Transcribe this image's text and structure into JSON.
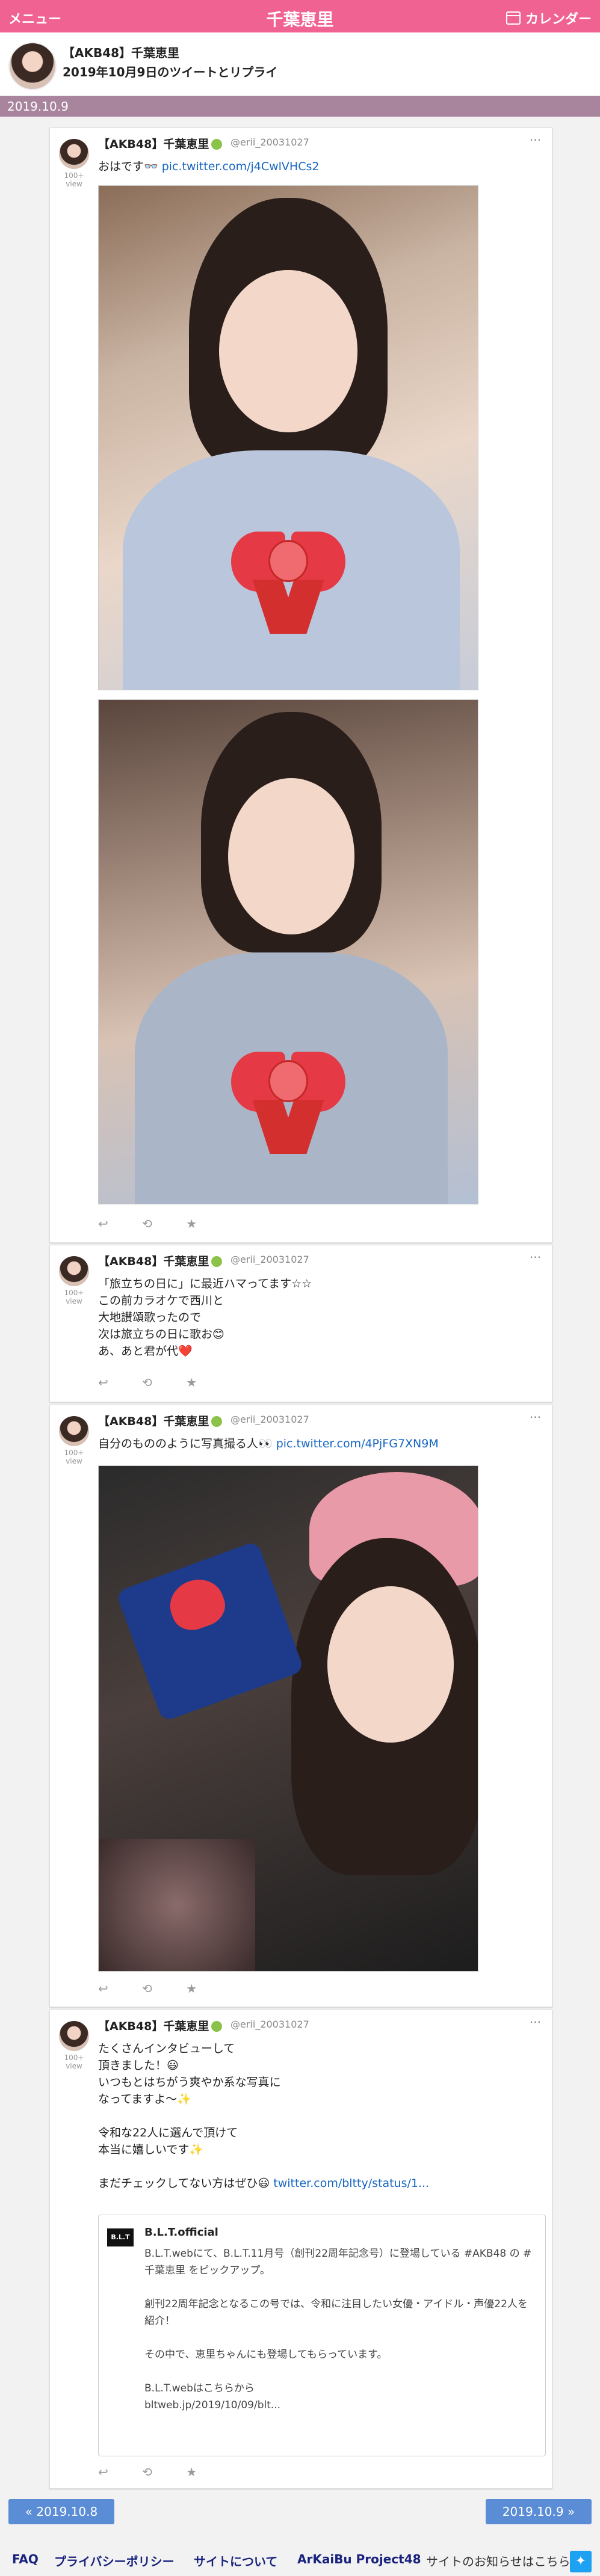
{
  "topbar": {
    "menu": "メニュー",
    "title": "千葉恵里",
    "calendar": "カレンダー"
  },
  "header": {
    "name": "【AKB48】千葉恵里",
    "subtitle": "2019年10月9日のツイートとリプライ"
  },
  "date_label": "2019.10.9",
  "tweets": [
    {
      "user": "【AKB48】千葉恵里",
      "handle": "@erii_20031027",
      "views": "100+\nview",
      "text": "おはです👓 ",
      "link": "pic.twitter.com/j4CwlVHCs2"
    },
    {
      "user": "【AKB48】千葉恵里",
      "handle": "@erii_20031027",
      "views": "100+\nview",
      "text": "「旅立ちの日に」に最近ハマってます☆☆\nこの前カラオケで西川と\n大地讃頌歌ったので\n次は旅立ちの日に歌お😊\nあ、あと君が代❤️"
    },
    {
      "user": "【AKB48】千葉恵里",
      "handle": "@erii_20031027",
      "views": "100+\nview",
      "text": "自分のもののように写真撮る人👀 ",
      "link": "pic.twitter.com/4PjFG7XN9M"
    },
    {
      "user": "【AKB48】千葉恵里",
      "handle": "@erii_20031027",
      "views": "100+\nview",
      "text": "たくさんインタビューして\n頂きました！😃\nいつもとはちがう爽やか系な写真に\nなってますよ〜✨\n\n令和な22人に選んで頂けて\n本当に嬉しいです✨\n\nまだチェックしてない方はぜひ😃 ",
      "link": "twitter.com/bltty/status/1...",
      "quote": {
        "name": "B.L.T.official",
        "badge": "B.L.T",
        "text": "B.L.T.webにて、B.L.T.11月号（創刊22周年記念号）に登場している #AKB48 の #千葉恵里 をピックアップ。\n\n創刊22周年記念となるこの号では、令和に注目したい女優・アイドル・声優22人を紹介！\n\nその中で、恵里ちゃんにも登場してもらっています。\n\nB.L.T.webはこちらから\nbltweb.jp/2019/10/09/blt..."
      }
    }
  ],
  "actions": {
    "reply": "↩",
    "retweet": "⟲",
    "like": "★"
  },
  "more": "···",
  "pager": {
    "prev": "« 2019.10.8",
    "next": "2019.10.9 »"
  },
  "footer": {
    "faq": "FAQ",
    "privacy": "プライバシーポリシー",
    "about": "サイトについて",
    "brand": "ArKaiBu Project48",
    "notice": "サイトのお知らせはこちら"
  }
}
